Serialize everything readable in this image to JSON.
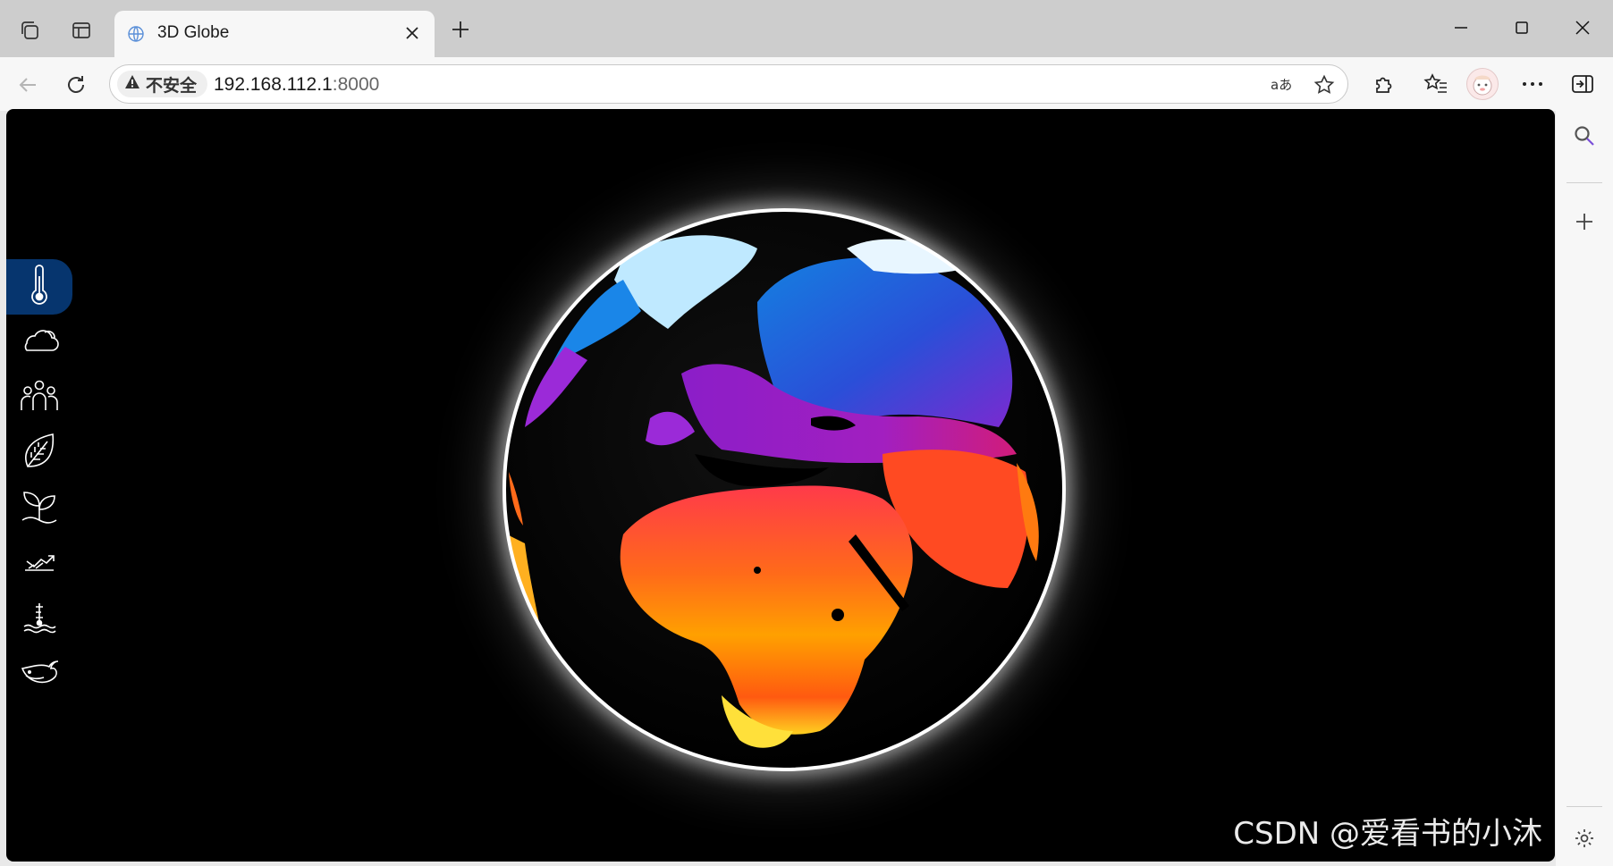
{
  "tab": {
    "title": "3D Globe"
  },
  "address_bar": {
    "security_label": "不安全",
    "url_host": "192.168.112.1",
    "url_port": ":8000"
  },
  "app": {
    "sidebar": {
      "items": [
        {
          "icon": "thermometer-icon",
          "active": true
        },
        {
          "icon": "cloud-icon",
          "active": false
        },
        {
          "icon": "people-icon",
          "active": false
        },
        {
          "icon": "leaf-icon",
          "active": false
        },
        {
          "icon": "sprout-icon",
          "active": false
        },
        {
          "icon": "trend-icon",
          "active": false
        },
        {
          "icon": "sea-level-icon",
          "active": false
        },
        {
          "icon": "whale-icon",
          "active": false
        }
      ]
    },
    "globe": {
      "layer": "surface temperature"
    }
  },
  "watermark": "CSDN @爱看书的小沐",
  "colors": {
    "active_menu": "#06356e",
    "viewport_bg": "#000000",
    "globe_cold": "#1d6fe0",
    "globe_hot": "#ffb000"
  }
}
